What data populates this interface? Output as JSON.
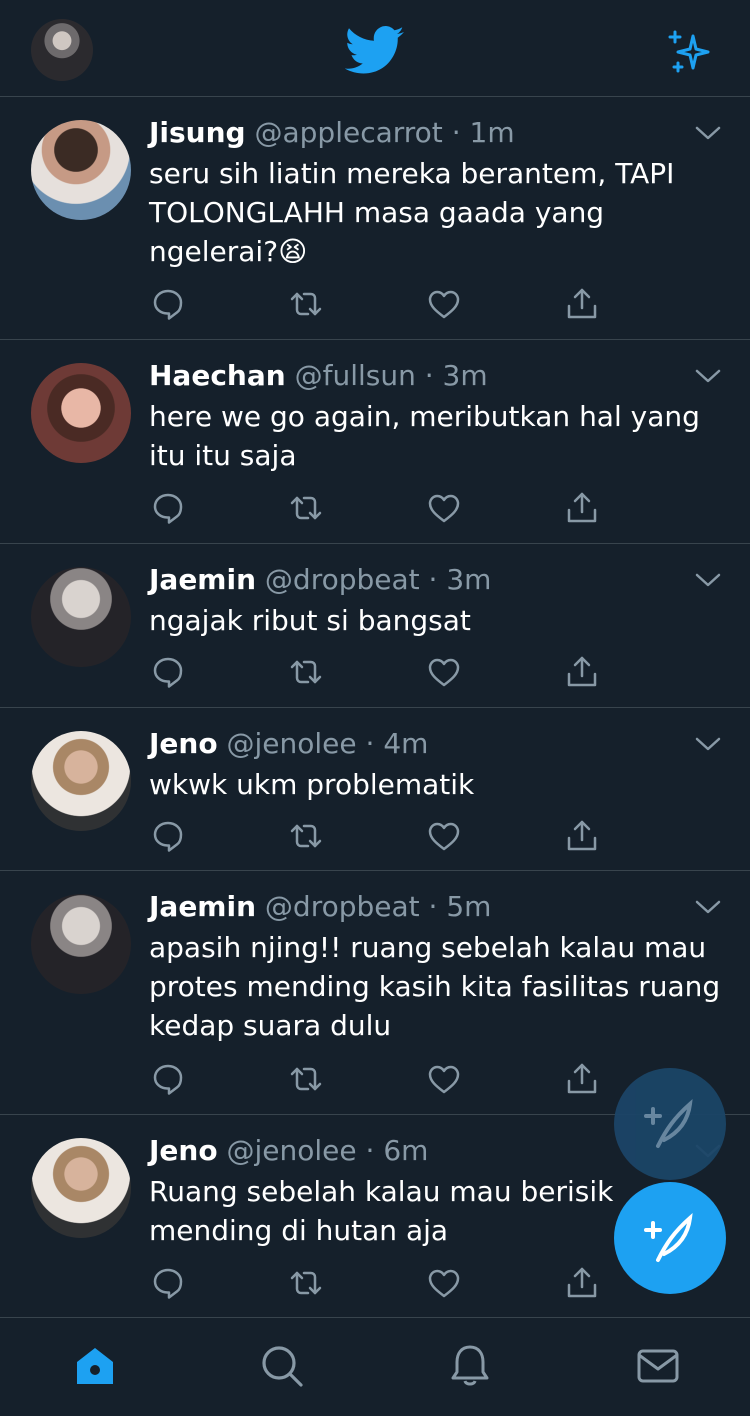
{
  "colors": {
    "background": "#15202b",
    "divider": "#38444d",
    "muted": "#8899a6",
    "accent": "#1da1f2",
    "text": "#ffffff"
  },
  "header": {
    "profile_icon": "user-avatar",
    "logo_icon": "twitter-bird-icon",
    "sparkle_icon": "sparkle-icon"
  },
  "tweets": [
    {
      "name": "Jisung",
      "handle": "@applecarrot",
      "time": "1m",
      "text": "seru sih liatin mereka berantem, TAPI TOLONGLAHH masa gaada yang ngelerai?😫"
    },
    {
      "name": "Haechan",
      "handle": "@fullsun",
      "time": "3m",
      "text": "here we go again, meributkan hal yang itu itu saja"
    },
    {
      "name": "Jaemin",
      "handle": "@dropbeat",
      "time": "3m",
      "text": "ngajak ribut si bangsat"
    },
    {
      "name": "Jeno",
      "handle": "@jenolee",
      "time": "4m",
      "text": "wkwk ukm problematik"
    },
    {
      "name": "Jaemin",
      "handle": "@dropbeat",
      "time": "5m",
      "text": "apasih njing!! ruang sebelah kalau mau protes mending kasih kita fasilitas ruang kedap suara dulu"
    },
    {
      "name": "Jeno",
      "handle": "@jenolee",
      "time": "6m",
      "text": "Ruang sebelah kalau mau berisik mending di hutan aja"
    }
  ],
  "tweet_actions": [
    "reply-icon",
    "retweet-icon",
    "like-icon",
    "share-icon"
  ],
  "compose_icon": "compose-tweet-icon",
  "bottom_nav": [
    "home-icon",
    "search-icon",
    "notifications-icon",
    "messages-icon"
  ],
  "active_nav": "home-icon"
}
